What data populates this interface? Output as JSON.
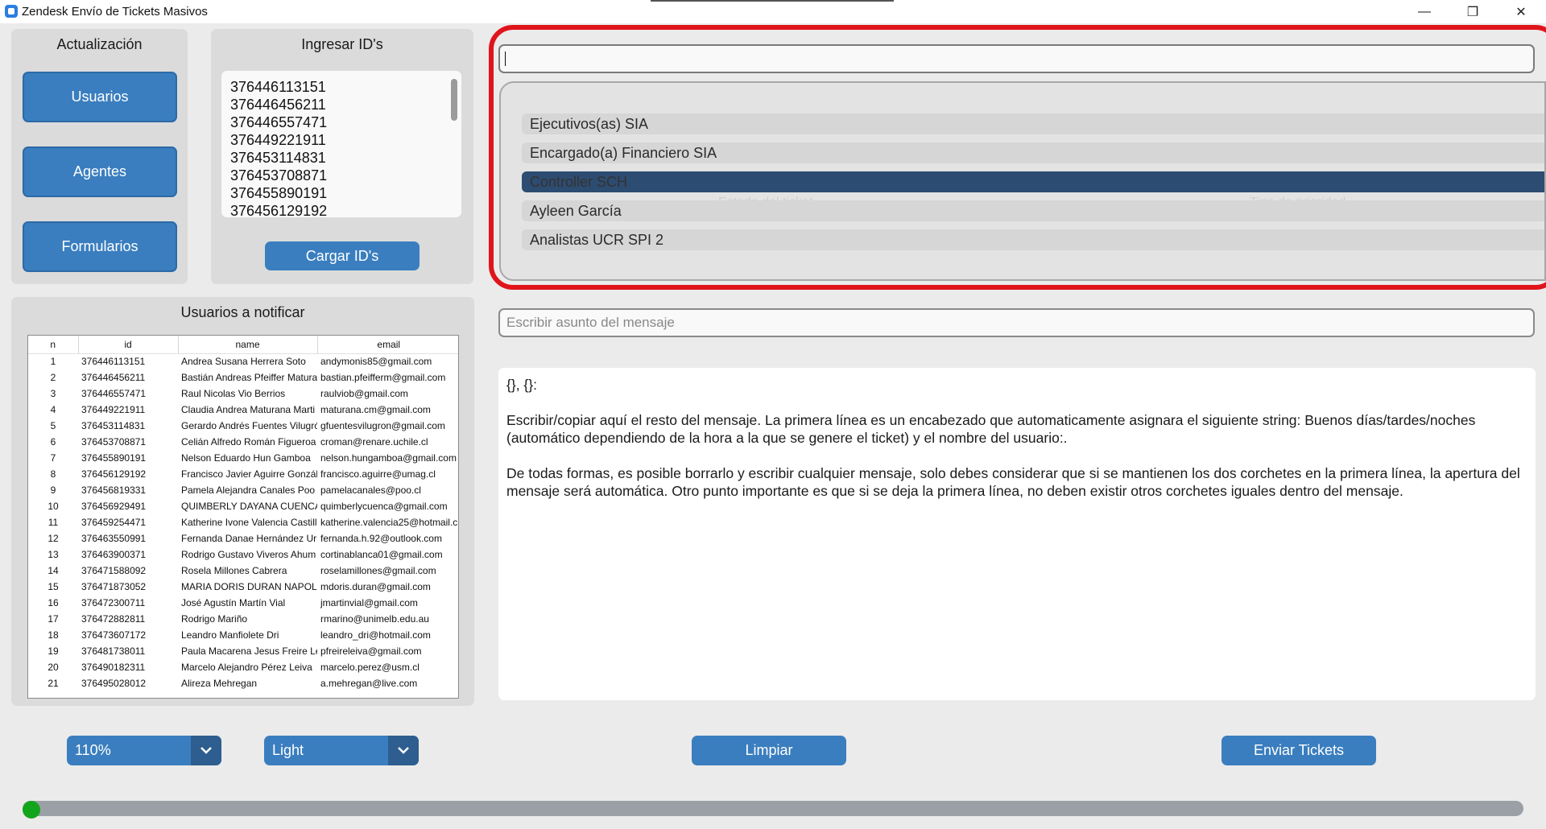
{
  "window": {
    "title": "Zendesk Envío de Tickets Masivos",
    "controls": {
      "minimize": "—",
      "restore": "❐",
      "close": "✕"
    }
  },
  "update_panel": {
    "title": "Actualización",
    "buttons": [
      "Usuarios",
      "Agentes",
      "Formularios"
    ]
  },
  "ids_panel": {
    "title": "Ingresar ID's",
    "ids": [
      "376446113151",
      "376446456211",
      "376446557471",
      "376449221911",
      "376453114831",
      "376453708871",
      "376455890191",
      "376456129192"
    ],
    "load_button": "Cargar ID's"
  },
  "users_panel": {
    "title": "Usuarios a notificar",
    "columns": [
      "n",
      "id",
      "name",
      "email"
    ],
    "rows": [
      [
        "1",
        "376446113151",
        "Andrea Susana Herrera Soto",
        "andymonis85@gmail.com"
      ],
      [
        "2",
        "376446456211",
        "Bastián Andreas Pfeiffer Matura",
        "bastian.pfeifferm@gmail.com"
      ],
      [
        "3",
        "376446557471",
        "Raul Nicolas Vio Berrios",
        "raulviob@gmail.com"
      ],
      [
        "4",
        "376449221911",
        "Claudia Andrea Maturana Marti",
        "maturana.cm@gmail.com"
      ],
      [
        "5",
        "376453114831",
        "Gerardo Andrés Fuentes Vilugró",
        "gfuentesvilugron@gmail.com"
      ],
      [
        "6",
        "376453708871",
        "Celián Alfredo Román Figueroa",
        "croman@renare.uchile.cl"
      ],
      [
        "7",
        "376455890191",
        "Nelson Eduardo Hun Gamboa",
        "nelson.hungamboa@gmail.com"
      ],
      [
        "8",
        "376456129192",
        "Francisco Javier Aguirre Gonzál",
        "francisco.aguirre@umag.cl"
      ],
      [
        "9",
        "376456819331",
        "Pamela Alejandra Canales Poo",
        "pamelacanales@poo.cl"
      ],
      [
        "10",
        "376456929491",
        "QUIMBERLY DAYANA CUENCA",
        "quimberlycuenca@gmail.com"
      ],
      [
        "11",
        "376459254471",
        "Katherine Ivone Valencia Castill",
        "katherine.valencia25@hotmail.c"
      ],
      [
        "12",
        "376463550991",
        "Fernanda Danae Hernández Urr",
        "fernanda.h.92@outlook.com"
      ],
      [
        "13",
        "376463900371",
        "Rodrigo Gustavo Viveros Ahum",
        "cortinablanca01@gmail.com"
      ],
      [
        "14",
        "376471588092",
        "Rosela Millones Cabrera",
        "roselamillones@gmail.com"
      ],
      [
        "15",
        "376471873052",
        "MARIA DORIS DURAN NAPOLI",
        "mdoris.duran@gmail.com"
      ],
      [
        "16",
        "376472300711",
        "José Agustín Martín Vial",
        "jmartinvial@gmail.com"
      ],
      [
        "17",
        "376472882811",
        "Rodrigo Mariño",
        "rmarino@unimelb.edu.au"
      ],
      [
        "18",
        "376473607172",
        "Leandro Manfiolete Dri",
        "leandro_dri@hotmail.com"
      ],
      [
        "19",
        "376481738011",
        "Paula Macarena Jesus Freire Lei",
        "pfreireleiva@gmail.com"
      ],
      [
        "20",
        "376490182311",
        "Marcelo Alejandro Pérez Leiva",
        "marcelo.perez@usm.cl"
      ],
      [
        "21",
        "376495028012",
        "Alireza Mehregan",
        "a.mehregan@live.com"
      ]
    ]
  },
  "dropdown": {
    "search_value": "",
    "options": [
      "Ejecutivos(as) SIA",
      "Encargado(a) Financiero SIA",
      "Controller SCH",
      "Ayleen García",
      "Analistas UCR SPI 2"
    ],
    "selected_index": 2,
    "background_ghost_labels": [
      "Estado del ticket",
      "Tipo de prioridad"
    ]
  },
  "subject": {
    "placeholder": "Escribir asunto del mensaje",
    "value": ""
  },
  "message": {
    "paragraphs": [
      "{}, {}:",
      "Escribir/copiar aquí el resto del mensaje. La primera línea es un encabezado que automaticamente asignara el siguiente string: Buenos días/tardes/noches (automático dependiendo de la hora a la que se genere el ticket) y el nombre del usuario:.",
      "De todas formas, es posible borrarlo y escribir cualquier mensaje, solo debes considerar que si se mantienen los dos corchetes en la primera línea, la apertura del mensaje será automática. Otro punto importante es que si se deja la primera línea, no deben existir otros corchetes iguales dentro del mensaje."
    ]
  },
  "bottom": {
    "zoom_value": "110%",
    "theme_value": "Light",
    "clear_button": "Limpiar",
    "send_button": "Enviar Tickets",
    "progress": 0
  },
  "colors": {
    "accent": "#3a7ebf",
    "selected": "#2d4c71",
    "highlight_ring": "#e0141b",
    "progress_knob": "#12a51c"
  }
}
